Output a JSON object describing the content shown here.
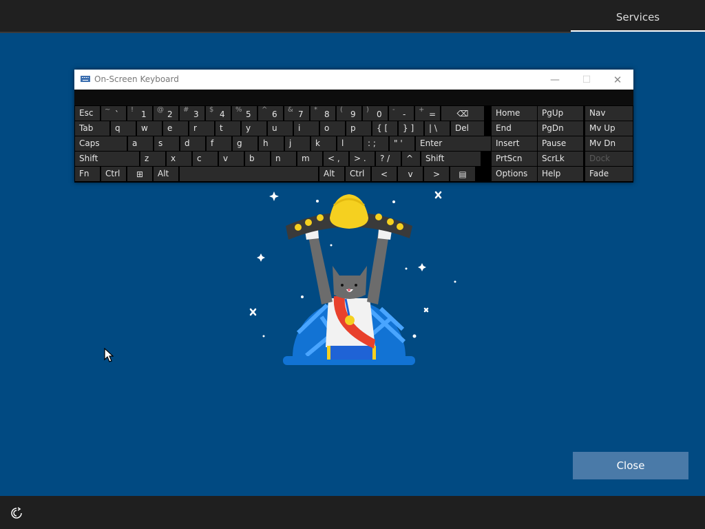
{
  "topbar": {
    "tab_label": "Services"
  },
  "osk": {
    "title": "On-Screen Keyboard",
    "minimize": "—",
    "maximize": "☐",
    "close": "✕",
    "row1": [
      {
        "lbl": "Esc"
      },
      {
        "sh": "~",
        "mn": "`"
      },
      {
        "sh": "!",
        "mn": "1"
      },
      {
        "sh": "@",
        "mn": "2"
      },
      {
        "sh": "#",
        "mn": "3"
      },
      {
        "sh": "$",
        "mn": "4"
      },
      {
        "sh": "%",
        "mn": "5"
      },
      {
        "sh": "^",
        "mn": "6"
      },
      {
        "sh": "&",
        "mn": "7"
      },
      {
        "sh": "*",
        "mn": "8"
      },
      {
        "sh": "(",
        "mn": "9"
      },
      {
        "sh": ")",
        "mn": "0"
      },
      {
        "sh": "-",
        "mn": "-"
      },
      {
        "sh": "+",
        "mn": "="
      },
      {
        "lbl": "⌫"
      }
    ],
    "row2": [
      "Tab",
      "q",
      "w",
      "e",
      "r",
      "t",
      "y",
      "u",
      "i",
      "o",
      "p",
      "{ [",
      "} ]",
      "| \\",
      "Del"
    ],
    "row3": [
      "Caps",
      "a",
      "s",
      "d",
      "f",
      "g",
      "h",
      "j",
      "k",
      "l",
      ": ;",
      "\" '",
      "Enter"
    ],
    "row4": [
      "Shift",
      "z",
      "x",
      "c",
      "v",
      "b",
      "n",
      "m",
      "< ,",
      "> .",
      "? /",
      "^",
      "Shift"
    ],
    "row5": [
      "Fn",
      "Ctrl",
      "⊞",
      "Alt",
      "",
      "Alt",
      "Ctrl",
      "<",
      "v",
      ">",
      "▤"
    ],
    "nav_left": [
      "Home",
      "End",
      "Insert",
      "PrtScn",
      "Options"
    ],
    "nav_mid": [
      "PgUp",
      "PgDn",
      "Pause",
      "ScrLk",
      "Help"
    ],
    "nav_right": [
      "Nav",
      "Mv Up",
      "Mv Dn",
      "Dock",
      "Fade"
    ]
  },
  "close_button": "Close",
  "colors": {
    "background": "#014a82",
    "bar": "#202020",
    "button": "#4a7aa8",
    "key": "#2b2b2b"
  }
}
